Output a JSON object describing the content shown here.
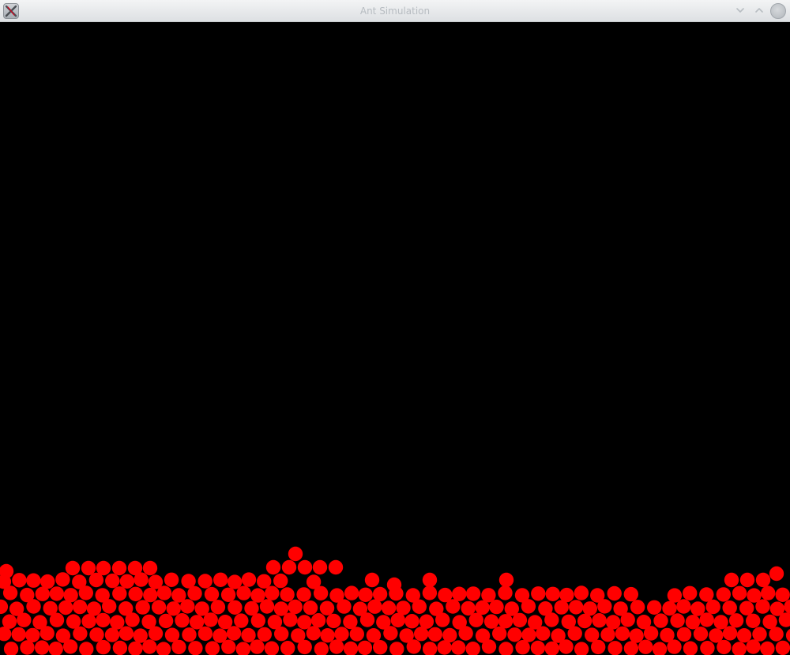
{
  "window": {
    "title": "Ant Simulation",
    "icon": "x-app-icon",
    "controls": {
      "minimize_icon": "chevron-down-icon",
      "maximize_icon": "chevron-up-icon",
      "close_icon": "close-circle-icon"
    }
  },
  "simulation": {
    "background_color": "#000000",
    "ant_color": "#ff0000",
    "description_visible": false
  }
}
